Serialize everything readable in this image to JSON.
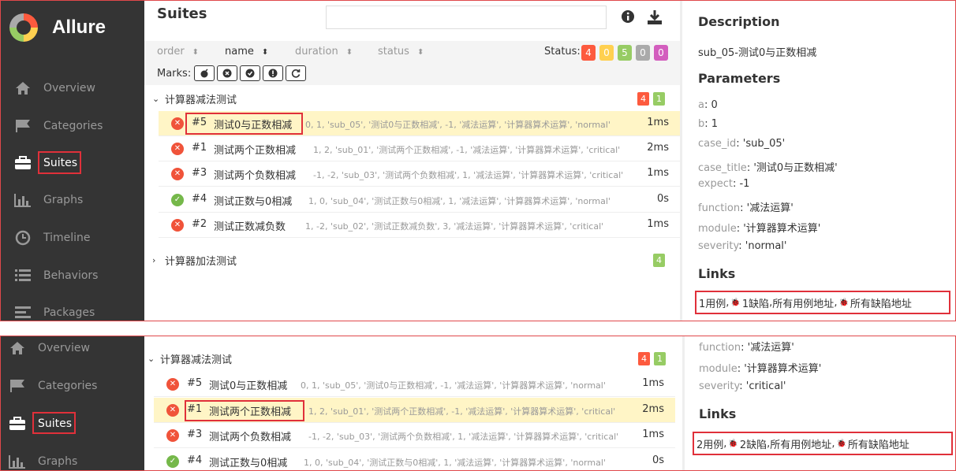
{
  "app": {
    "name": "Allure",
    "title": "Suites"
  },
  "colors": {
    "broken": "#f0533a",
    "failed": "#fd5a3e",
    "skipped": "#ffd050",
    "passed": "#97cc64",
    "unknown": "#aaaaaa",
    "unknown_purple": "#d35ebe",
    "highlight": "#e0303a",
    "sidebar": "#343434"
  },
  "nav": [
    {
      "label": "Overview",
      "icon": "home-icon"
    },
    {
      "label": "Categories",
      "icon": "flag-icon"
    },
    {
      "label": "Suites",
      "icon": "briefcase-icon"
    },
    {
      "label": "Graphs",
      "icon": "bar-chart-icon"
    },
    {
      "label": "Timeline",
      "icon": "clock-icon"
    },
    {
      "label": "Behaviors",
      "icon": "list-icon"
    },
    {
      "label": "Packages",
      "icon": "align-left-icon"
    }
  ],
  "toolbar": {
    "info_icon": "info-icon",
    "download_icon": "download-icon"
  },
  "sort": {
    "order": "order",
    "name": "name",
    "duration": "duration",
    "status": "status"
  },
  "status": {
    "label": "Status:",
    "counts": [
      "4",
      "0",
      "5",
      "0",
      "0"
    ]
  },
  "marks": {
    "label": "Marks:",
    "icons": [
      "flaky-icon",
      "new-failed-icon",
      "new-passed-icon",
      "new-broken-icon",
      "retries-icon"
    ]
  },
  "groups": [
    {
      "name": "计算器减法测试",
      "counts": [
        "4",
        "1"
      ]
    },
    {
      "name": "计算器加法测试",
      "counts": [
        "4"
      ]
    }
  ],
  "tests": [
    {
      "order": "#5",
      "name": "测试0与正数相减",
      "params": "0, 1, 'sub_05', '测试0与正数相减', -1, '减法运算', '计算器算术运算', 'normal'",
      "duration": "1ms",
      "status": "broken"
    },
    {
      "order": "#1",
      "name": "测试两个正数相减",
      "params": "1, 2, 'sub_01', '测试两个正数相减', -1, '减法运算', '计算器算术运算', 'critical'",
      "duration": "2ms",
      "status": "broken"
    },
    {
      "order": "#3",
      "name": "测试两个负数相减",
      "params": "-1, -2, 'sub_03', '测试两个负数相减', 1, '减法运算', '计算器算术运算', 'critical'",
      "duration": "1ms",
      "status": "broken"
    },
    {
      "order": "#4",
      "name": "测试正数与0相减",
      "params": "1, 0, 'sub_04', '测试正数与0相减', 1, '减法运算', '计算器算术运算', 'normal'",
      "duration": "0s",
      "status": "passed"
    },
    {
      "order": "#2",
      "name": "测试正数减负数",
      "params": "1, -2, 'sub_02', '测试正数减负数', 3, '减法运算', '计算器算术运算', 'critical'",
      "duration": "1ms",
      "status": "broken"
    }
  ],
  "detail1": {
    "description_h": "Description",
    "description": "sub_05-测试0与正数相减",
    "parameters_h": "Parameters",
    "params": [
      {
        "k": "a",
        "v": "0"
      },
      {
        "k": "b",
        "v": "1"
      },
      {
        "k": "case_id",
        "v": "'sub_05'"
      },
      {
        "k": "case_title",
        "v": "'测试0与正数相减'"
      },
      {
        "k": "expect",
        "v": "-1"
      },
      {
        "k": "function",
        "v": "'减法运算'"
      },
      {
        "k": "module",
        "v": "'计算器算术运算'"
      },
      {
        "k": "severity",
        "v": "'normal'"
      }
    ],
    "links_h": "Links",
    "links": {
      "a": "1用例",
      "b": "1缺陷",
      "c": "所有用例地址",
      "d": "所有缺陷地址",
      "sep": " , "
    }
  },
  "detail2": {
    "params": [
      {
        "k": "function",
        "v": "'减法运算'"
      },
      {
        "k": "module",
        "v": "'计算器算术运算'"
      },
      {
        "k": "severity",
        "v": "'critical'"
      }
    ],
    "links_h": "Links",
    "links": {
      "a": "2用例",
      "b": "2缺陷",
      "c": "所有用例地址",
      "d": "所有缺陷地址",
      "sep": " , "
    }
  }
}
